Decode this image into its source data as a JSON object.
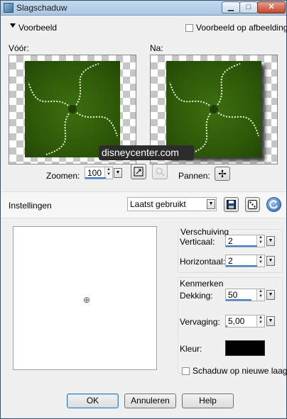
{
  "window": {
    "title": "Slagschaduw",
    "min_glyph": "▁",
    "max_glyph": "□",
    "close_glyph": "✕"
  },
  "preview_section": {
    "header": "Voorbeeld",
    "preview_checkbox_label": "Voorbeeld op afbeelding",
    "preview_checkbox_checked": false,
    "before_label": "Vóór:",
    "after_label": "Na:",
    "zoom_label": "Zoomen:",
    "zoom_value": "100",
    "pan_label": "Pannen:",
    "watermark": "disneycenter.com"
  },
  "settings": {
    "label": "Instellingen",
    "preset_value": "Laatst gebruikt"
  },
  "offset": {
    "group_title": "Verschuiving",
    "vertical_label": "Verticaal:",
    "vertical_value": "2",
    "horizontal_label": "Horizontaal:",
    "horizontal_value": "2"
  },
  "properties": {
    "group_title": "Kenmerken",
    "opacity_label": "Dekking:",
    "opacity_value": "50",
    "blur_label": "Vervaging:",
    "blur_value": "5,00",
    "color_label": "Kleur:",
    "color_value": "#000000"
  },
  "shadow_layer": {
    "label": "Schaduw op nieuwe laag",
    "checked": false
  },
  "buttons": {
    "ok": "OK",
    "cancel": "Annuleren",
    "help": "Help"
  }
}
